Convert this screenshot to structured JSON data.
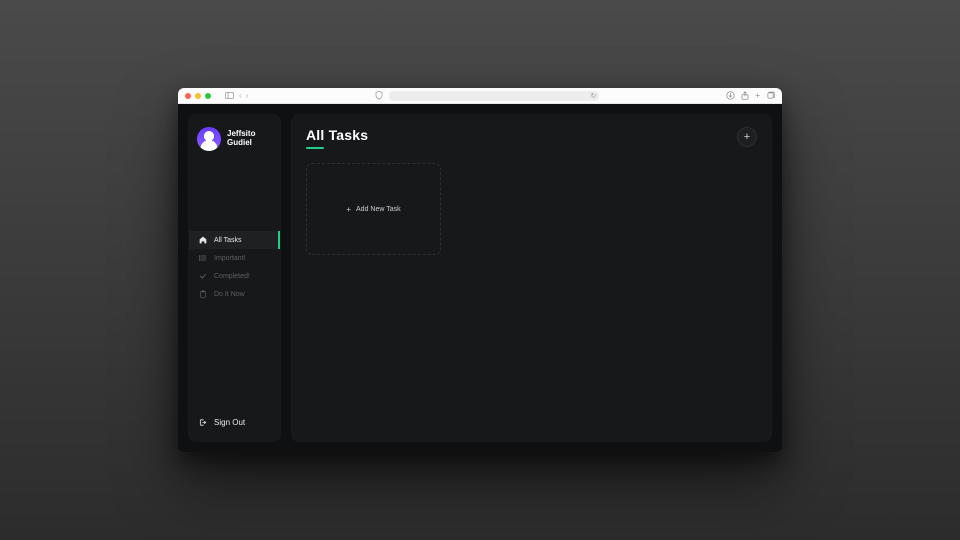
{
  "profile": {
    "name": "Jeffsito Gudiel"
  },
  "sidebar": {
    "items": [
      {
        "label": "All Tasks",
        "icon": "home-icon",
        "active": true
      },
      {
        "label": "Important!",
        "icon": "list-icon",
        "active": false
      },
      {
        "label": "Completed!",
        "icon": "check-icon",
        "active": false
      },
      {
        "label": "Do It Now",
        "icon": "clipboard-icon",
        "active": false
      }
    ],
    "signout_label": "Sign Out"
  },
  "main": {
    "title": "All Tasks",
    "add_card_label": "Add New Task"
  }
}
